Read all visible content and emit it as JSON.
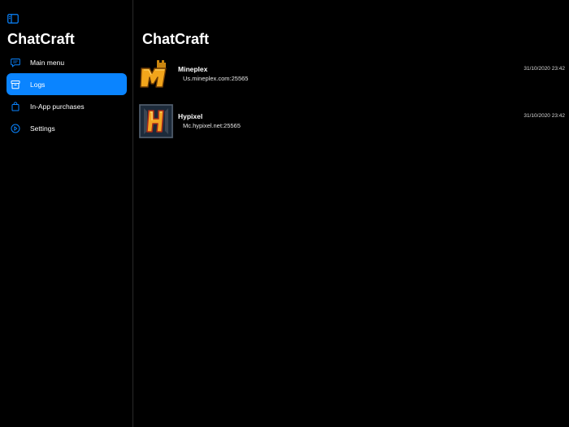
{
  "sidebar": {
    "title": "ChatCraft",
    "items": [
      {
        "label": "Main menu",
        "icon": "chat-bubble-icon",
        "active": false
      },
      {
        "label": "Logs",
        "icon": "archive-box-icon",
        "active": true
      },
      {
        "label": "In-App purchases",
        "icon": "shopping-bag-icon",
        "active": false
      },
      {
        "label": "Settings",
        "icon": "play-circle-icon",
        "active": false
      }
    ]
  },
  "main": {
    "title": "ChatCraft",
    "servers": [
      {
        "name": "Mineplex",
        "address": "Us.mineplex.com:25565",
        "time": "31/10/2020 23:42",
        "logo": "mineplex-logo"
      },
      {
        "name": "Hypixel",
        "address": "Mc.hypixel.net:25565",
        "time": "31/10/2020 23:42",
        "logo": "hypixel-logo"
      }
    ]
  },
  "colors": {
    "accent": "#0a84ff",
    "background": "#000000",
    "text": "#ffffff"
  }
}
